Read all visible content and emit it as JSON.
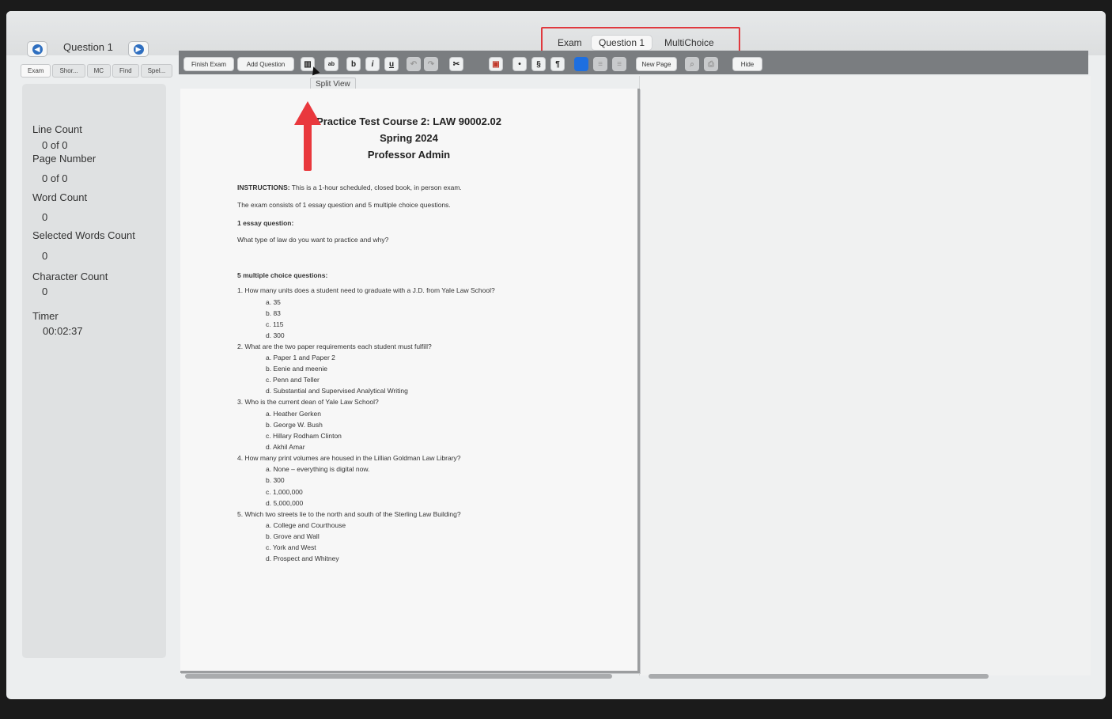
{
  "header": {
    "question_title": "Question 1",
    "prev_icon": "back-arrow-icon",
    "next_icon": "forward-arrow-icon"
  },
  "left_tabs": [
    "Exam",
    "Shor...",
    "MC",
    "Find",
    "Spel..."
  ],
  "mode_tabs": {
    "exam": "Exam",
    "question": "Question 1",
    "multichoice": "MultiChoice"
  },
  "toolbar": {
    "finish_exam": "Finish Exam",
    "add_question": "Add Question",
    "bold": "b",
    "italic": "i",
    "underline": "u",
    "section": "§",
    "paragraph": "¶",
    "new_page": "New Page",
    "hide": "Hide"
  },
  "tooltip": "Split View",
  "stats": {
    "line_count_label": "Line Count",
    "line_count_value": "0 of 0",
    "page_number_label": "Page Number",
    "page_number_value": "0 of 0",
    "word_count_label": "Word Count",
    "word_count_value": "0",
    "selected_words_label": "Selected Words Count",
    "selected_words_value": "0",
    "character_count_label": "Character Count",
    "character_count_value": "0",
    "timer_label": "Timer",
    "timer_value": "00:02:37"
  },
  "document": {
    "title1": "Practice Test Course 2: LAW 90002.02",
    "title2": "Spring 2024",
    "title3": "Professor Admin",
    "instructions_label": "INSTRUCTIONS:",
    "instructions_text": " This is a 1-hour scheduled, closed book, in person exam.",
    "consists": "The exam consists of 1 essay question and 5 multiple choice questions.",
    "essay_header": "1 essay question:",
    "essay_q": "What type of law do you want to practice and why?",
    "mc_header": "5 multiple choice questions:",
    "q1": "1.   How many units does a student need to graduate with a J.D. from Yale Law School?",
    "q1a": "a.   35",
    "q1b": "b.   83",
    "q1c": "c.   115",
    "q1d": "d.   300",
    "q2": "2.   What are the two paper requirements each student must fulfill?",
    "q2a": "a.   Paper 1 and Paper 2",
    "q2b": "b.   Eenie and meenie",
    "q2c": "c.   Penn and Teller",
    "q2d": "d.   Substantial and Supervised Analytical Writing",
    "q3": "3.   Who is the current dean of Yale Law School?",
    "q3a": "a.   Heather Gerken",
    "q3b": "b.   George W. Bush",
    "q3c": "c.   Hillary Rodham Clinton",
    "q3d": "d.   Akhil Amar",
    "q4": "4.   How many print volumes are housed in the Lillian Goldman Law Library?",
    "q4a": "a.   None – everything is digital now.",
    "q4b": "b.   300",
    "q4c": "c.   1,000,000",
    "q4d": "d.   5,000,000",
    "q5": "5.   Which two streets lie to the north and south of the Sterling Law Building?",
    "q5a": "a.   College and Courthouse",
    "q5b": "b.   Grove and Wall",
    "q5c": "c.   York and West",
    "q5d": "d.   Prospect and Whitney"
  },
  "colors": {
    "accent_blue": "#2f6fc0",
    "highlight_red": "#e0393e",
    "toolbar_gray": "#7a7d80"
  }
}
